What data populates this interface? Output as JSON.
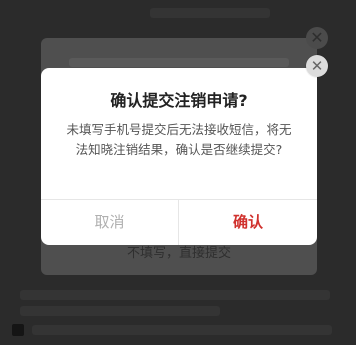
{
  "dialog": {
    "title": "确认提交注销申请?",
    "message": "未填写手机号提交后无法接收短信，将无法知晓注销结果，确认是否继续提交?",
    "cancel_label": "取消",
    "confirm_label": "确认",
    "close_icon": "close-icon"
  },
  "underlying_dialog": {
    "button_text": "不填写，直接提交",
    "close_icon": "close-icon"
  },
  "colors": {
    "confirm": "#d0312d",
    "cancel": "#b0b0b0",
    "overlay": "#2a2a2a"
  }
}
